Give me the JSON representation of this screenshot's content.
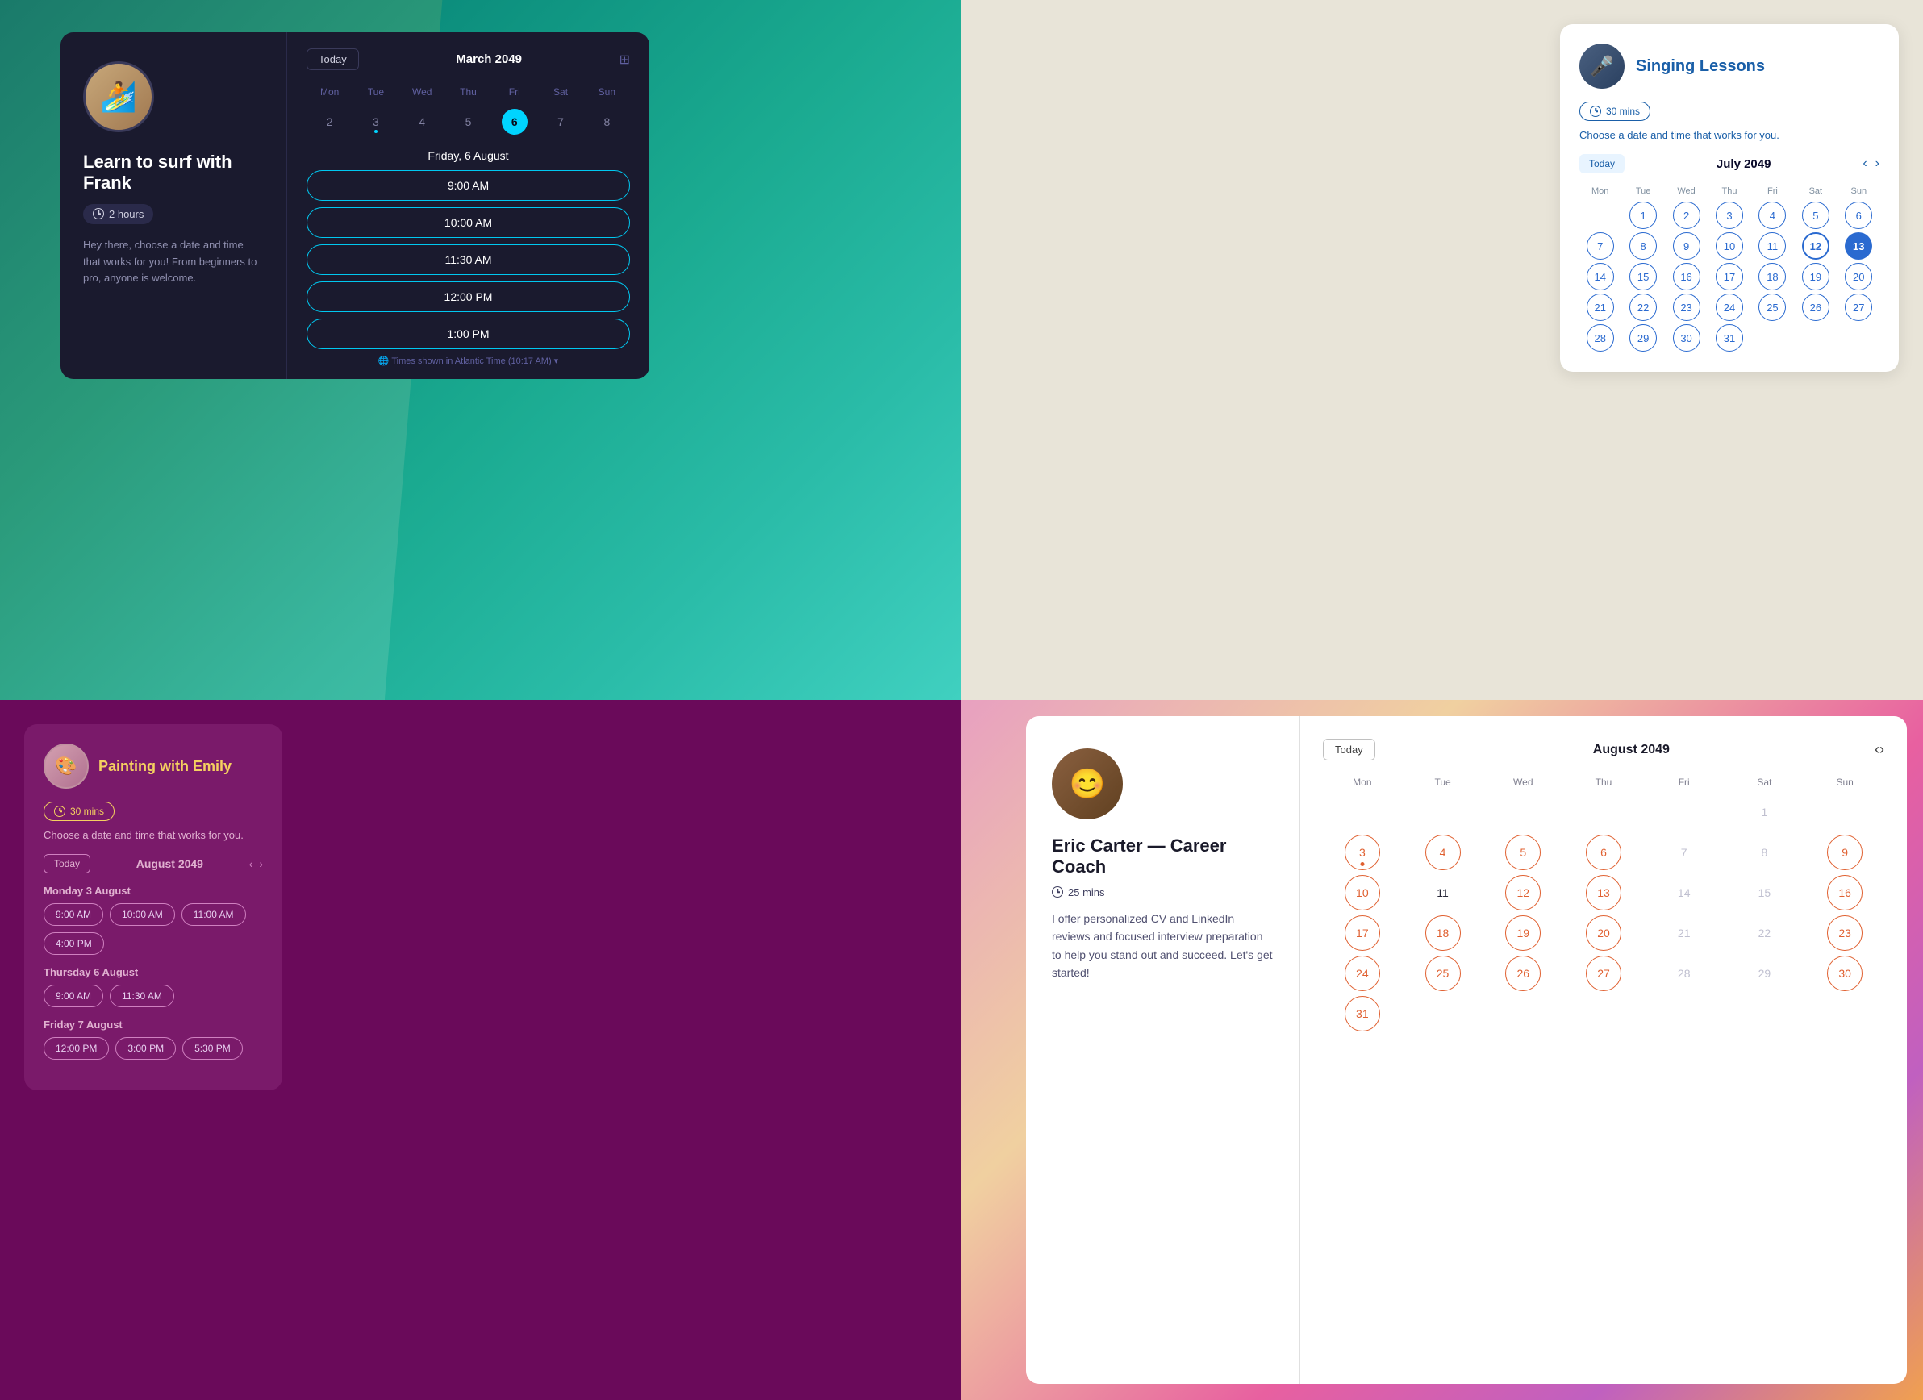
{
  "surf": {
    "title": "Learn to surf with Frank",
    "duration_label": "2 hours",
    "description": "Hey there, choose a date and time that works for you! From beginners to pro, anyone is welcome.",
    "calendar": {
      "today_btn": "Today",
      "month": "March 2049",
      "weekdays": [
        "Mon",
        "Tue",
        "Wed",
        "Thu",
        "Fri",
        "Sat",
        "Sun"
      ],
      "days": [
        {
          "n": "2",
          "active": false,
          "dot": false
        },
        {
          "n": "3",
          "active": false,
          "dot": true
        },
        {
          "n": "4",
          "active": false,
          "dot": false
        },
        {
          "n": "5",
          "active": false,
          "dot": false
        },
        {
          "n": "6",
          "active": true,
          "dot": false
        },
        {
          "n": "7",
          "active": false,
          "dot": false
        },
        {
          "n": "8",
          "active": false,
          "dot": false
        }
      ]
    },
    "date_header": "Friday, 6 August",
    "time_slots": [
      "9:00 AM",
      "10:00 AM",
      "11:30 AM",
      "12:00 PM",
      "1:00 PM"
    ],
    "timezone": "Times shown in Atlantic Time (10:17 AM)"
  },
  "singing": {
    "title": "Singing Lessons",
    "duration_label": "30 mins",
    "subtitle": "Choose a date and time that works for you.",
    "calendar": {
      "today_btn": "Today",
      "month": "July 2049",
      "weekdays": [
        "Mon",
        "Tue",
        "Wed",
        "Thu",
        "Fri",
        "Sat",
        "Sun"
      ],
      "empty_start": 0,
      "days_in_month": 31,
      "selected_day": 13,
      "today_day": 12,
      "circled_days": [
        2,
        3,
        4,
        5,
        6,
        7,
        8,
        9,
        10,
        11,
        12,
        13,
        16,
        17,
        18,
        19,
        20,
        21,
        22,
        23,
        24,
        25,
        26,
        27,
        28,
        29,
        30,
        31
      ]
    }
  },
  "painting": {
    "title": "Painting with Emily",
    "duration_label": "30 mins",
    "subtitle": "Choose a date and time that works for you.",
    "calendar": {
      "today_btn": "Today",
      "month": "August 2049"
    },
    "groups": [
      {
        "label": "Monday 3 August",
        "slots": [
          "9:00 AM",
          "10:00 AM",
          "11:00 AM",
          "4:00 PM"
        ]
      },
      {
        "label": "Thursday 6 August",
        "slots": [
          "9:00 AM",
          "11:30 AM"
        ]
      },
      {
        "label": "Friday 7 August",
        "slots": [
          "12:00 PM",
          "3:00 PM",
          "5:30 PM"
        ]
      }
    ]
  },
  "eric": {
    "name": "Eric Carter — Career Coach",
    "duration_label": "25 mins",
    "description": "I offer personalized CV and LinkedIn reviews and focused interview preparation to help you stand out and succeed. Let's get started!",
    "calendar": {
      "today_btn": "Today",
      "month": "August 2049",
      "weekdays": [
        "Mon",
        "Tue",
        "Wed",
        "Thu",
        "Fri",
        "Sat",
        "Sun"
      ],
      "circled_days": [
        3,
        4,
        5,
        6,
        9,
        10,
        12,
        13,
        16,
        17,
        18,
        19,
        20,
        23,
        24,
        25,
        26,
        27,
        30,
        31
      ],
      "dot_days": [
        3
      ]
    }
  }
}
